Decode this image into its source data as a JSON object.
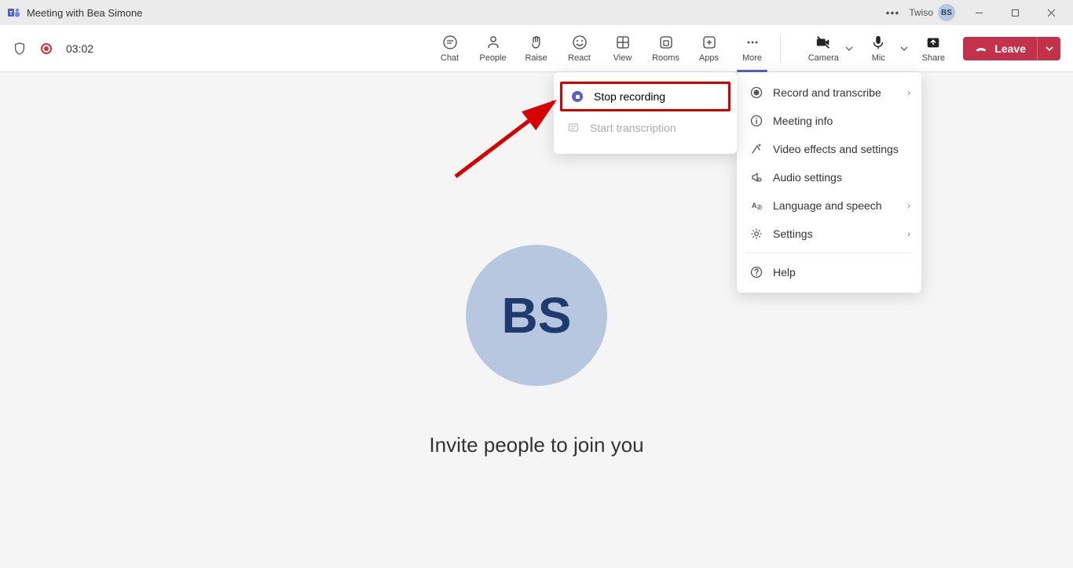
{
  "titlebar": {
    "title": "Meeting with Bea Simone",
    "user_name": "Twiso",
    "user_initials": "BS"
  },
  "toolbar": {
    "timer": "03:02",
    "buttons": {
      "chat": "Chat",
      "people": "People",
      "raise": "Raise",
      "react": "React",
      "view": "View",
      "rooms": "Rooms",
      "apps": "Apps",
      "more": "More"
    },
    "controls": {
      "camera": "Camera",
      "mic": "Mic",
      "share": "Share"
    },
    "leave": "Leave"
  },
  "stage": {
    "avatar_initials": "BS",
    "invite": "Invite people to join you"
  },
  "more_menu": {
    "record": "Record and transcribe",
    "info": "Meeting info",
    "video": "Video effects and settings",
    "audio": "Audio settings",
    "lang": "Language and speech",
    "settings": "Settings",
    "help": "Help"
  },
  "record_submenu": {
    "stop": "Stop recording",
    "start_transcription": "Start transcription"
  }
}
